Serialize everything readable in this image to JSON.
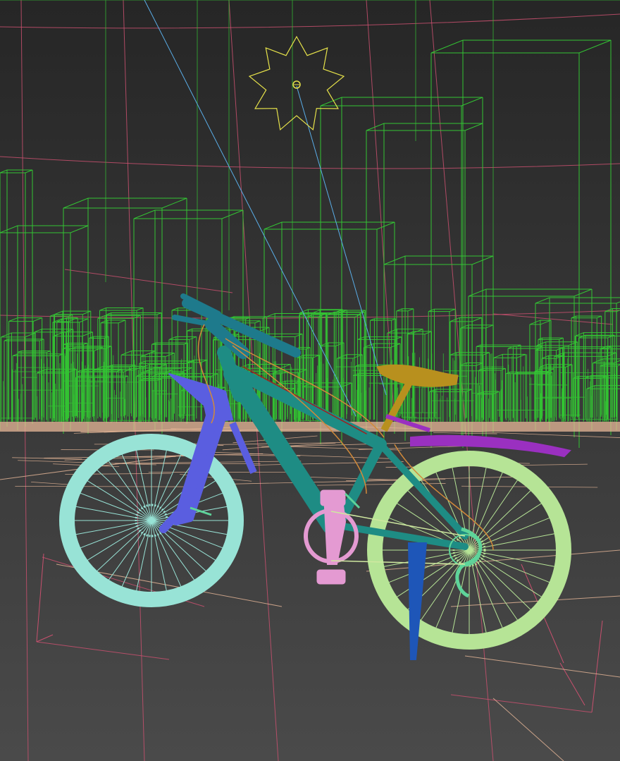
{
  "viewport": {
    "background_top": "#262626",
    "background_bottom": "#4a4a4a"
  },
  "colors": {
    "buildings": "#33c433",
    "ground_grid": "#c8506e",
    "ground_lines": "#e8b898",
    "light": "#e6e24a",
    "light_target_line": "#5aaee8",
    "front_wheel": "#98e3d6",
    "rear_wheel": "#b6e496",
    "fork": "#5a5ee0",
    "frame": "#1e8c84",
    "handlebar": "#1e7a8c",
    "saddle": "#b8901e",
    "fender": "#9a30c0",
    "pedals": "#e49ad2",
    "derailleur": "#5ed49a",
    "kickstand": "#1e56b8",
    "cables": "#d28a3a"
  },
  "icons": {
    "light": "star-light-icon"
  }
}
